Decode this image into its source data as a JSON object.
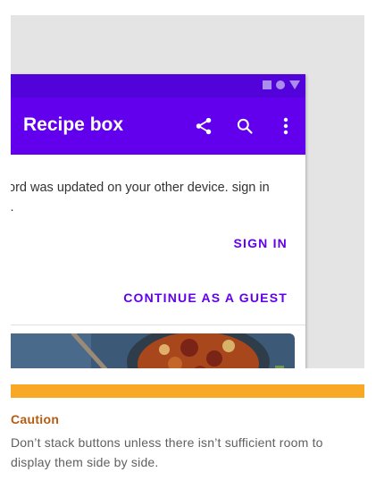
{
  "status_bar": {
    "icons": [
      "square-icon",
      "circle-icon",
      "triangle-icon"
    ]
  },
  "app_bar": {
    "title": "Recipe box",
    "actions": [
      "share-icon",
      "search-icon",
      "more-vert-icon"
    ]
  },
  "dialog": {
    "message": "assword was updated on your other device. sign in again.",
    "buttons": {
      "sign_in": "SIGN IN",
      "continue_guest": "CONTINUE AS A GUEST"
    }
  },
  "caution": {
    "title": "Caution",
    "text": "Don’t stack buttons unless there isn’t sufficient room to display them side by side."
  },
  "colors": {
    "status_bar": "#5203d9",
    "app_bar": "#6200ee",
    "button_text": "#6200ee",
    "caution_bar": "#f9a825",
    "caution_title": "#b65c12"
  }
}
